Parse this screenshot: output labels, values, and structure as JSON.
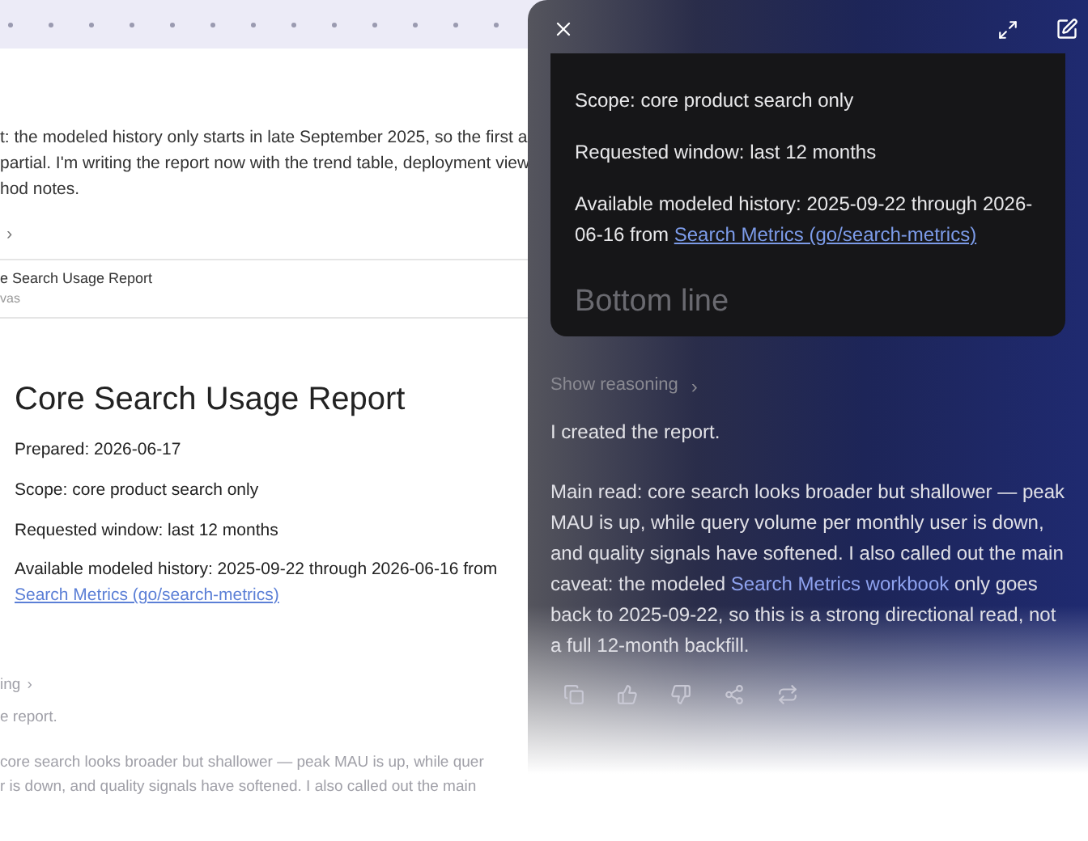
{
  "page": {
    "intro_lines": [
      "t: the modeled history only starts in late September 2025, so the first a",
      "partial. I'm writing the report now with the trend table, deployment view",
      "hod notes."
    ],
    "chevron": "›",
    "doc_card": {
      "title": "e Search Usage Report",
      "subtitle": "vas"
    },
    "report": {
      "heading": "Core Search Usage Report",
      "lines": [
        "Prepared: 2026-06-17",
        "Scope: core product search only",
        "Requested window: last 12 months"
      ],
      "history": "Available modeled history: 2025-09-22 through 2026-06-16 from",
      "link": "Search Metrics (go/search-metrics)"
    },
    "faded": {
      "reasoning": "ing",
      "chevron": "›",
      "reply": "e report.",
      "lines": [
        "core search looks broader but shallower — peak MAU is up, while quer",
        "r is down, and quality signals have softened. I also called out the main"
      ]
    }
  },
  "panel": {
    "card": {
      "lines": [
        "Scope: core product search only",
        "Requested window: last 12 months"
      ],
      "history": "Available modeled history: 2025-09-22 through 2026-06-16 from",
      "link": "Search Metrics (go/search-metrics)",
      "next_heading": "Bottom line"
    },
    "show_reasoning": "Show reasoning",
    "chevron": "›",
    "reply": "I created the report.",
    "main_text": "Main read: core search looks broader but shallower — peak MAU is up, while query volume per monthly user is down, and quality signals have softened. I also called out the main caveat: the modeled",
    "main_link": "Search Metrics workbook",
    "main_text_end": "only goes back to 2025-09-22, so this is a strong directional read, not a full 12-month backfill."
  }
}
